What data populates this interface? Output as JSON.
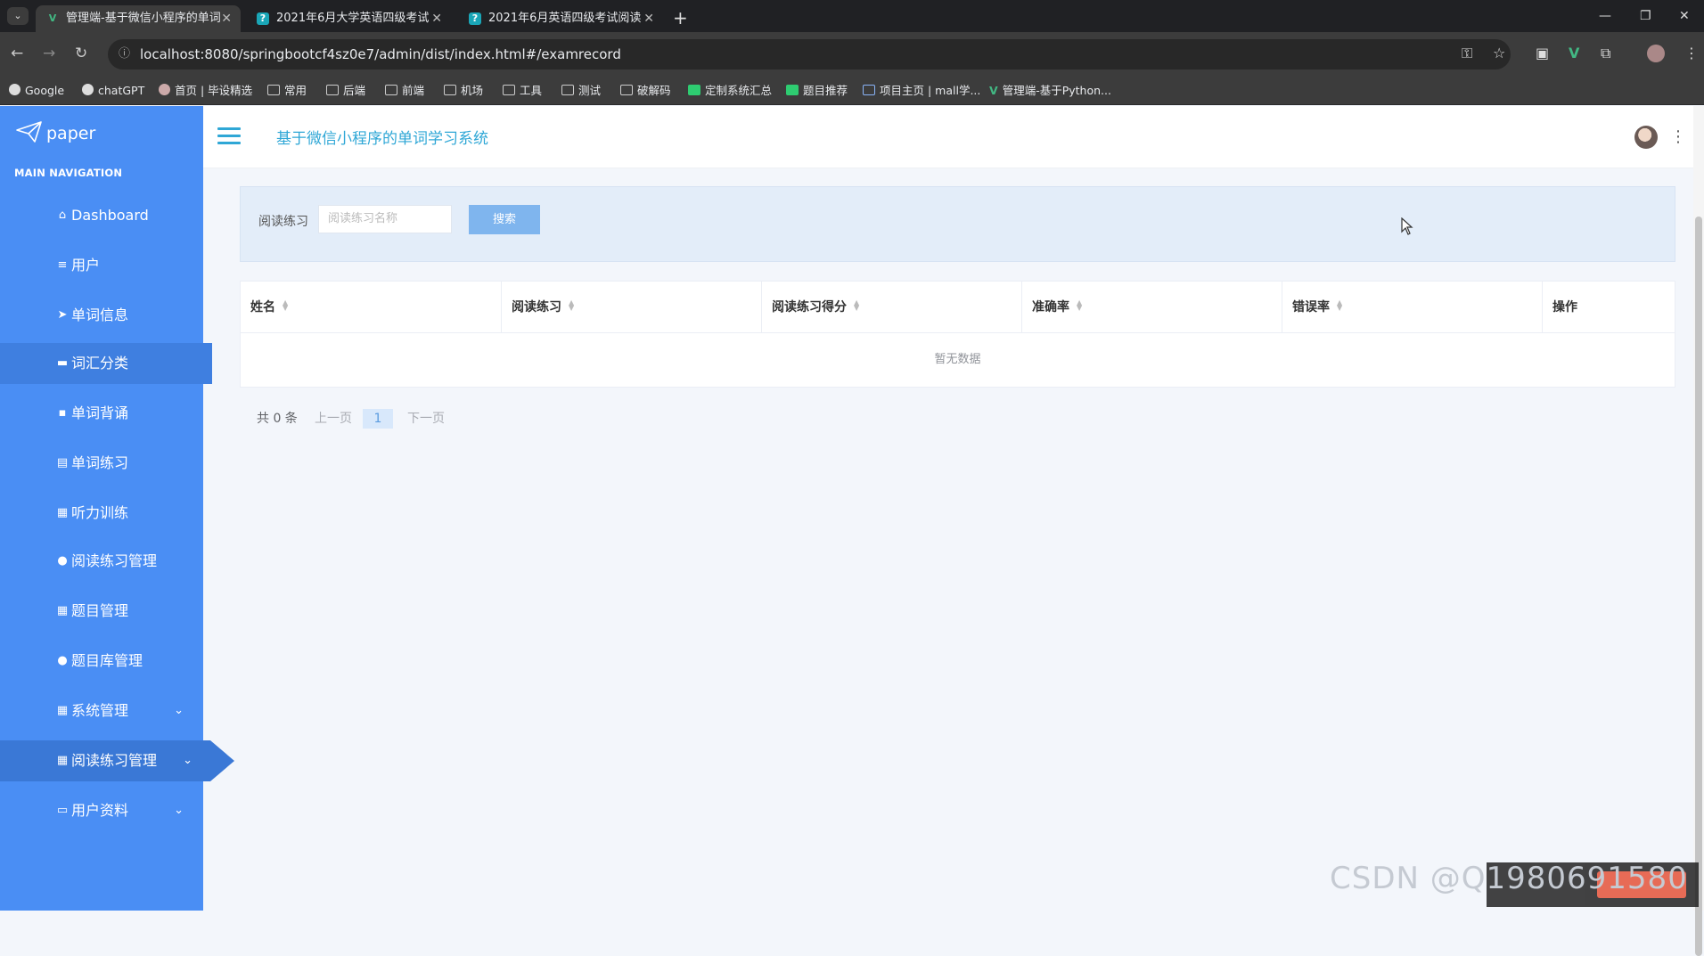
{
  "browser": {
    "tabs": [
      {
        "title": "管理端-基于微信小程序的单词",
        "active": true
      },
      {
        "title": "2021年6月大学英语四级考试",
        "active": false
      },
      {
        "title": "2021年6月英语四级考试阅读",
        "active": false
      }
    ],
    "url": "localhost:8080/springbootcf4sz0e7/admin/dist/index.html#/examrecord",
    "bookmarks": [
      "Google",
      "chatGPT",
      "首页 | 毕设精选",
      "常用",
      "后端",
      "前端",
      "机场",
      "工具",
      "测试",
      "破解码",
      "定制系统汇总",
      "题目推荐",
      "项目主页 | mall学...",
      "管理端-基于Python..."
    ]
  },
  "sidebar": {
    "logo": "paper",
    "heading": "MAIN NAVIGATION",
    "items": [
      {
        "label": "Dashboard",
        "icon": "home-icon"
      },
      {
        "label": "用户",
        "icon": "list-icon"
      },
      {
        "label": "单词信息",
        "icon": "paper-plane-icon"
      },
      {
        "label": "词汇分类",
        "icon": "ticket-icon"
      },
      {
        "label": "单词背诵",
        "icon": "chat-icon"
      },
      {
        "label": "单词练习",
        "icon": "clipboard-icon"
      },
      {
        "label": "听力训练",
        "icon": "grid-icon"
      },
      {
        "label": "阅读练习管理",
        "icon": "user-icon"
      },
      {
        "label": "题目管理",
        "icon": "grid-icon"
      },
      {
        "label": "题目库管理",
        "icon": "pin-icon"
      },
      {
        "label": "系统管理",
        "icon": "grid-icon"
      },
      {
        "label": "阅读练习管理",
        "icon": "grid-icon"
      },
      {
        "label": "用户资料",
        "icon": "card-icon"
      }
    ]
  },
  "header": {
    "title": "基于微信小程序的单词学习系统"
  },
  "search": {
    "label": "阅读练习",
    "placeholder": "阅读练习名称",
    "button": "搜索"
  },
  "table": {
    "columns": [
      "姓名",
      "阅读练习",
      "阅读练习得分",
      "准确率",
      "错误率",
      "操作"
    ],
    "empty_text": "暂无数据"
  },
  "pagination": {
    "total": "共 0 条",
    "prev": "上一页",
    "current": "1",
    "next": "下一页"
  },
  "watermark": "CSDN @Q1980691580",
  "colors": {
    "sidebar": "#4a8ef4",
    "accent": "#2fa7d6",
    "search_button": "#7fb5ee"
  }
}
